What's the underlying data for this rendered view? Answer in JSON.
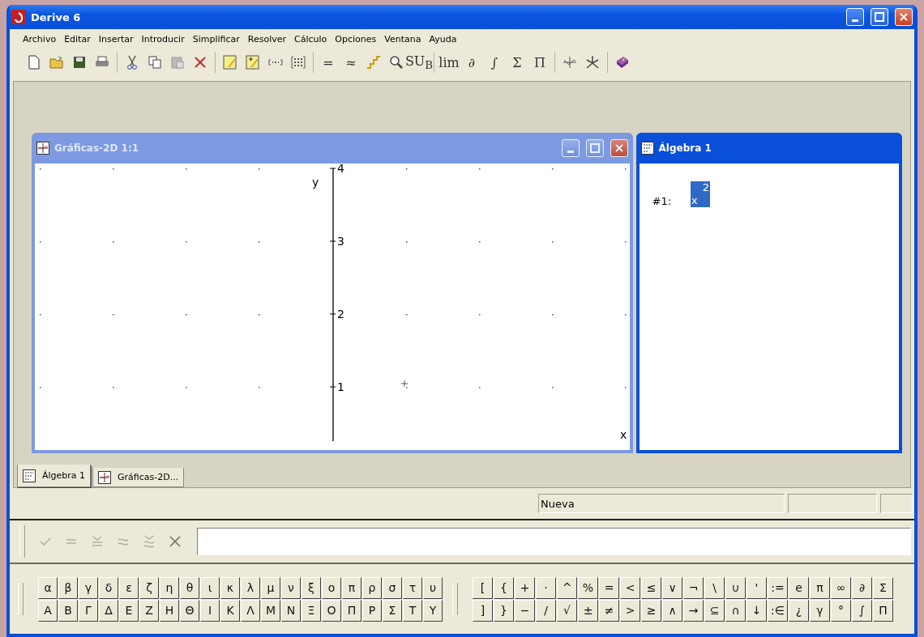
{
  "window": {
    "title": "Derive 6"
  },
  "menu": [
    "Archivo",
    "Editar",
    "Insertar",
    "Introducir",
    "Simplificar",
    "Resolver",
    "Cálculo",
    "Opciones",
    "Ventana",
    "Ayuda"
  ],
  "toolbar": [
    [
      {
        "kind": "new"
      },
      {
        "kind": "open"
      },
      {
        "kind": "save"
      },
      {
        "kind": "print"
      }
    ],
    [
      {
        "kind": "cut"
      },
      {
        "kind": "copy"
      },
      {
        "kind": "paste"
      },
      {
        "kind": "delete"
      }
    ],
    [
      {
        "kind": "author-text"
      },
      {
        "kind": "author-expr"
      },
      {
        "kind": "vector"
      },
      {
        "kind": "matrix"
      }
    ],
    [
      {
        "kind": "text",
        "label": "="
      },
      {
        "kind": "text",
        "label": "≈"
      },
      {
        "kind": "steps"
      },
      {
        "kind": "zoom"
      },
      {
        "kind": "text",
        "label": "SU$_{B}$"
      }
    ],
    [
      {
        "kind": "text",
        "label": "lim"
      },
      {
        "kind": "text",
        "label": "∂"
      },
      {
        "kind": "text",
        "label": "∫"
      },
      {
        "kind": "text",
        "label": "Σ"
      },
      {
        "kind": "text",
        "label": "Π"
      }
    ],
    [
      {
        "kind": "plot2d"
      },
      {
        "kind": "plot3d"
      }
    ],
    [
      {
        "kind": "book"
      }
    ]
  ],
  "plot_window": {
    "title": "Gráficas-2D 1:1",
    "active": false,
    "x_label": "x",
    "y_label": "y",
    "y_ticks": [
      "4",
      "3",
      "2",
      "1"
    ]
  },
  "algebra_window": {
    "title": "Álgebra 1",
    "active": true,
    "expressions": [
      {
        "label": "#1:",
        "base": "x",
        "exponent": "2",
        "selected": true
      }
    ]
  },
  "tabs": [
    {
      "label": "Álgebra 1",
      "kind": "algebra",
      "selected": true
    },
    {
      "label": "Gráficas-2D...",
      "kind": "plot",
      "selected": false
    }
  ],
  "status_bar": {
    "message": "Nueva"
  },
  "entry_buttons": [
    {
      "kind": "check",
      "disabled": true
    },
    {
      "kind": "equals",
      "disabled": true
    },
    {
      "kind": "check-equals",
      "disabled": true
    },
    {
      "kind": "approx",
      "disabled": true
    },
    {
      "kind": "check-approx",
      "disabled": true
    },
    {
      "kind": "cross",
      "disabled": false
    }
  ],
  "greek_keys": [
    [
      "α",
      "β",
      "γ",
      "δ",
      "ε",
      "ζ",
      "η",
      "θ",
      "ι",
      "κ",
      "λ",
      "μ",
      "ν",
      "ξ",
      "ο",
      "π",
      "ρ",
      "σ",
      "τ",
      "υ"
    ],
    [
      "Α",
      "Β",
      "Γ",
      "Δ",
      "Ε",
      "Ζ",
      "Η",
      "Θ",
      "Ι",
      "Κ",
      "Λ",
      "Μ",
      "Ν",
      "Ξ",
      "Ο",
      "Π",
      "Ρ",
      "Σ",
      "Τ",
      "Υ"
    ]
  ],
  "math_keys": [
    [
      "[",
      "{",
      "+",
      "·",
      "^",
      "%",
      "=",
      "<",
      "≤",
      "∨",
      "¬",
      "\\",
      "∪",
      "'",
      ":=",
      "e",
      "π",
      "∞",
      "∂",
      "Σ"
    ],
    [
      "]",
      "}",
      "−",
      "/",
      "√",
      "±",
      "≠",
      ">",
      "≥",
      "∧",
      "→",
      "⊆",
      "∩",
      "↓",
      ":∈",
      "¿",
      "γ",
      "°",
      "∫",
      "Π"
    ]
  ]
}
